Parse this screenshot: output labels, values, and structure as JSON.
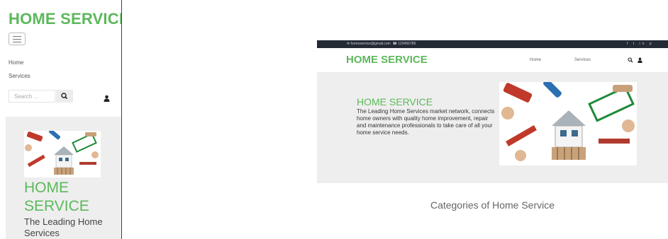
{
  "mobile": {
    "brand": "HOME SERVICE",
    "nav": [
      "Home",
      "Services"
    ],
    "search": {
      "placeholder": "Search ..."
    },
    "hero": {
      "title": "HOME SERVICE",
      "desc": "The Leading Home Services"
    }
  },
  "desktop": {
    "topbar": {
      "email": "homeservice@gmail.com",
      "phone": "123456789",
      "social": "f  t  in  p"
    },
    "brand": "HOME SERVICE",
    "nav": {
      "home": "Home",
      "services": "Services"
    },
    "hero": {
      "title": "HOME SERVICE",
      "desc": "The Leading Home Services market network, connects home owners with quality home improvement, repair and maintenance professionals to take care of all your home service needs."
    },
    "categories_heading": "Categories of Home Service"
  },
  "colors": {
    "brand": "#5cb85c",
    "topbar": "#232a33",
    "hero_bg": "#eeeeee"
  },
  "icons": [
    "hamburger-icon",
    "search-icon",
    "user-icon",
    "email-icon",
    "phone-icon",
    "facebook-icon",
    "twitter-icon",
    "linkedin-icon",
    "pinterest-icon"
  ]
}
